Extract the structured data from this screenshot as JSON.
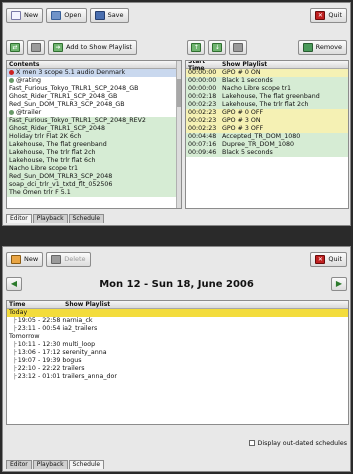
{
  "editor": {
    "toolbar": {
      "new": "New",
      "open": "Open",
      "save": "Save",
      "quit": "Quit"
    },
    "toolbar2": {
      "add_label": "Add to Show Playlist",
      "remove": "Remove"
    },
    "contents": {
      "header": "Contents",
      "items": [
        {
          "text": "X men 3 scope 5.1 audio Denmark",
          "style": "sel",
          "mark": "x"
        },
        {
          "text": "@rating",
          "style": "",
          "mark": "c"
        },
        {
          "text": "Fast_Furious_Tokyo_TRLR1_SCP_2048_GB",
          "style": "",
          "mark": ""
        },
        {
          "text": "Ghost_Rider_TRLR1_SCP_2048_GB",
          "style": "",
          "mark": ""
        },
        {
          "text": "Red_Sun_DOM_TRLR3_SCP_2048_GB",
          "style": "",
          "mark": ""
        },
        {
          "text": "@trailer",
          "style": "",
          "mark": "c"
        },
        {
          "text": "Fast_Furious_Tokyo_TRLR1_SCP_2048_REV2",
          "style": "green",
          "mark": ""
        },
        {
          "text": "Ghost_Rider_TRLR1_SCP_2048",
          "style": "green",
          "mark": ""
        },
        {
          "text": "Holiday trlr Flat 2K 6ch",
          "style": "green",
          "mark": ""
        },
        {
          "text": "Lakehouse, The flat greenband",
          "style": "green",
          "mark": ""
        },
        {
          "text": "Lakehouse, The trlr flat 2ch",
          "style": "green",
          "mark": ""
        },
        {
          "text": "Lakehouse, The trlr flat 6ch",
          "style": "green",
          "mark": ""
        },
        {
          "text": "Nacho Libre scope tr1",
          "style": "green",
          "mark": ""
        },
        {
          "text": "Red_Sun_DOM_TRLR3_SCP_2048",
          "style": "green",
          "mark": ""
        },
        {
          "text": "soap_dci_trlr_v1_txtd_flt_052506",
          "style": "green",
          "mark": ""
        },
        {
          "text": "The Omen trlr F 5.1",
          "style": "green",
          "mark": ""
        }
      ]
    },
    "playlist": {
      "col_time": "Start Time",
      "col_show": "Show Playlist",
      "rows": [
        {
          "time": "00:00:00",
          "show": "GPO # 0 ON",
          "style": "yellow"
        },
        {
          "time": "00:00:00",
          "show": "Black 1 seconds",
          "style": "green"
        },
        {
          "time": "00:00:00",
          "show": "Nacho Libre scope tr1",
          "style": "green"
        },
        {
          "time": "00:02:18",
          "show": "Lakehouse, The flat greenband",
          "style": "green"
        },
        {
          "time": "00:02:23",
          "show": "Lakehouse, The trlr flat 2ch",
          "style": "green"
        },
        {
          "time": "00:02:23",
          "show": "GPO # 0 OFF",
          "style": "yellow"
        },
        {
          "time": "00:02:23",
          "show": "GPO # 3 ON",
          "style": "yellow"
        },
        {
          "time": "00:02:23",
          "show": "GPO # 3 OFF",
          "style": "yellow"
        },
        {
          "time": "00:04:48",
          "show": "Accepted_TR_DOM_1080",
          "style": "green"
        },
        {
          "time": "00:07:16",
          "show": "Dupree_TR_DOM_1080",
          "style": "green"
        },
        {
          "time": "00:09:46",
          "show": "Black 5 seconds",
          "style": "green"
        }
      ]
    },
    "tabs": [
      "Editor",
      "Playback",
      "Schedule"
    ]
  },
  "schedule": {
    "toolbar": {
      "new": "New",
      "delete": "Delete",
      "quit": "Quit"
    },
    "title": "Mon 12 - Sun 18, June 2006",
    "col_time": "Time",
    "col_show": "Show Playlist",
    "rows": [
      {
        "text": "Today",
        "style": "today",
        "tree": false
      },
      {
        "text": "19:05 - 22:58 narnia_ck",
        "style": "",
        "tree": true
      },
      {
        "text": "23:11 - 00:54 ia2_trailers",
        "style": "",
        "tree": true
      },
      {
        "text": "Tomorrow",
        "style": "",
        "tree": false
      },
      {
        "text": "10:11 - 12:30 multi_loop",
        "style": "",
        "tree": true
      },
      {
        "text": "13:06 - 17:12 serenity_anna",
        "style": "",
        "tree": true
      },
      {
        "text": "19:07 - 19:39 bogus",
        "style": "",
        "tree": true
      },
      {
        "text": "22:10 - 22:22 trailers",
        "style": "",
        "tree": true
      },
      {
        "text": "23:12 - 01:01 trailers_anna_dor",
        "style": "",
        "tree": true
      }
    ],
    "checkbox_label": "Display out-dated schedules",
    "tabs": [
      "Editor",
      "Playback",
      "Schedule"
    ]
  }
}
